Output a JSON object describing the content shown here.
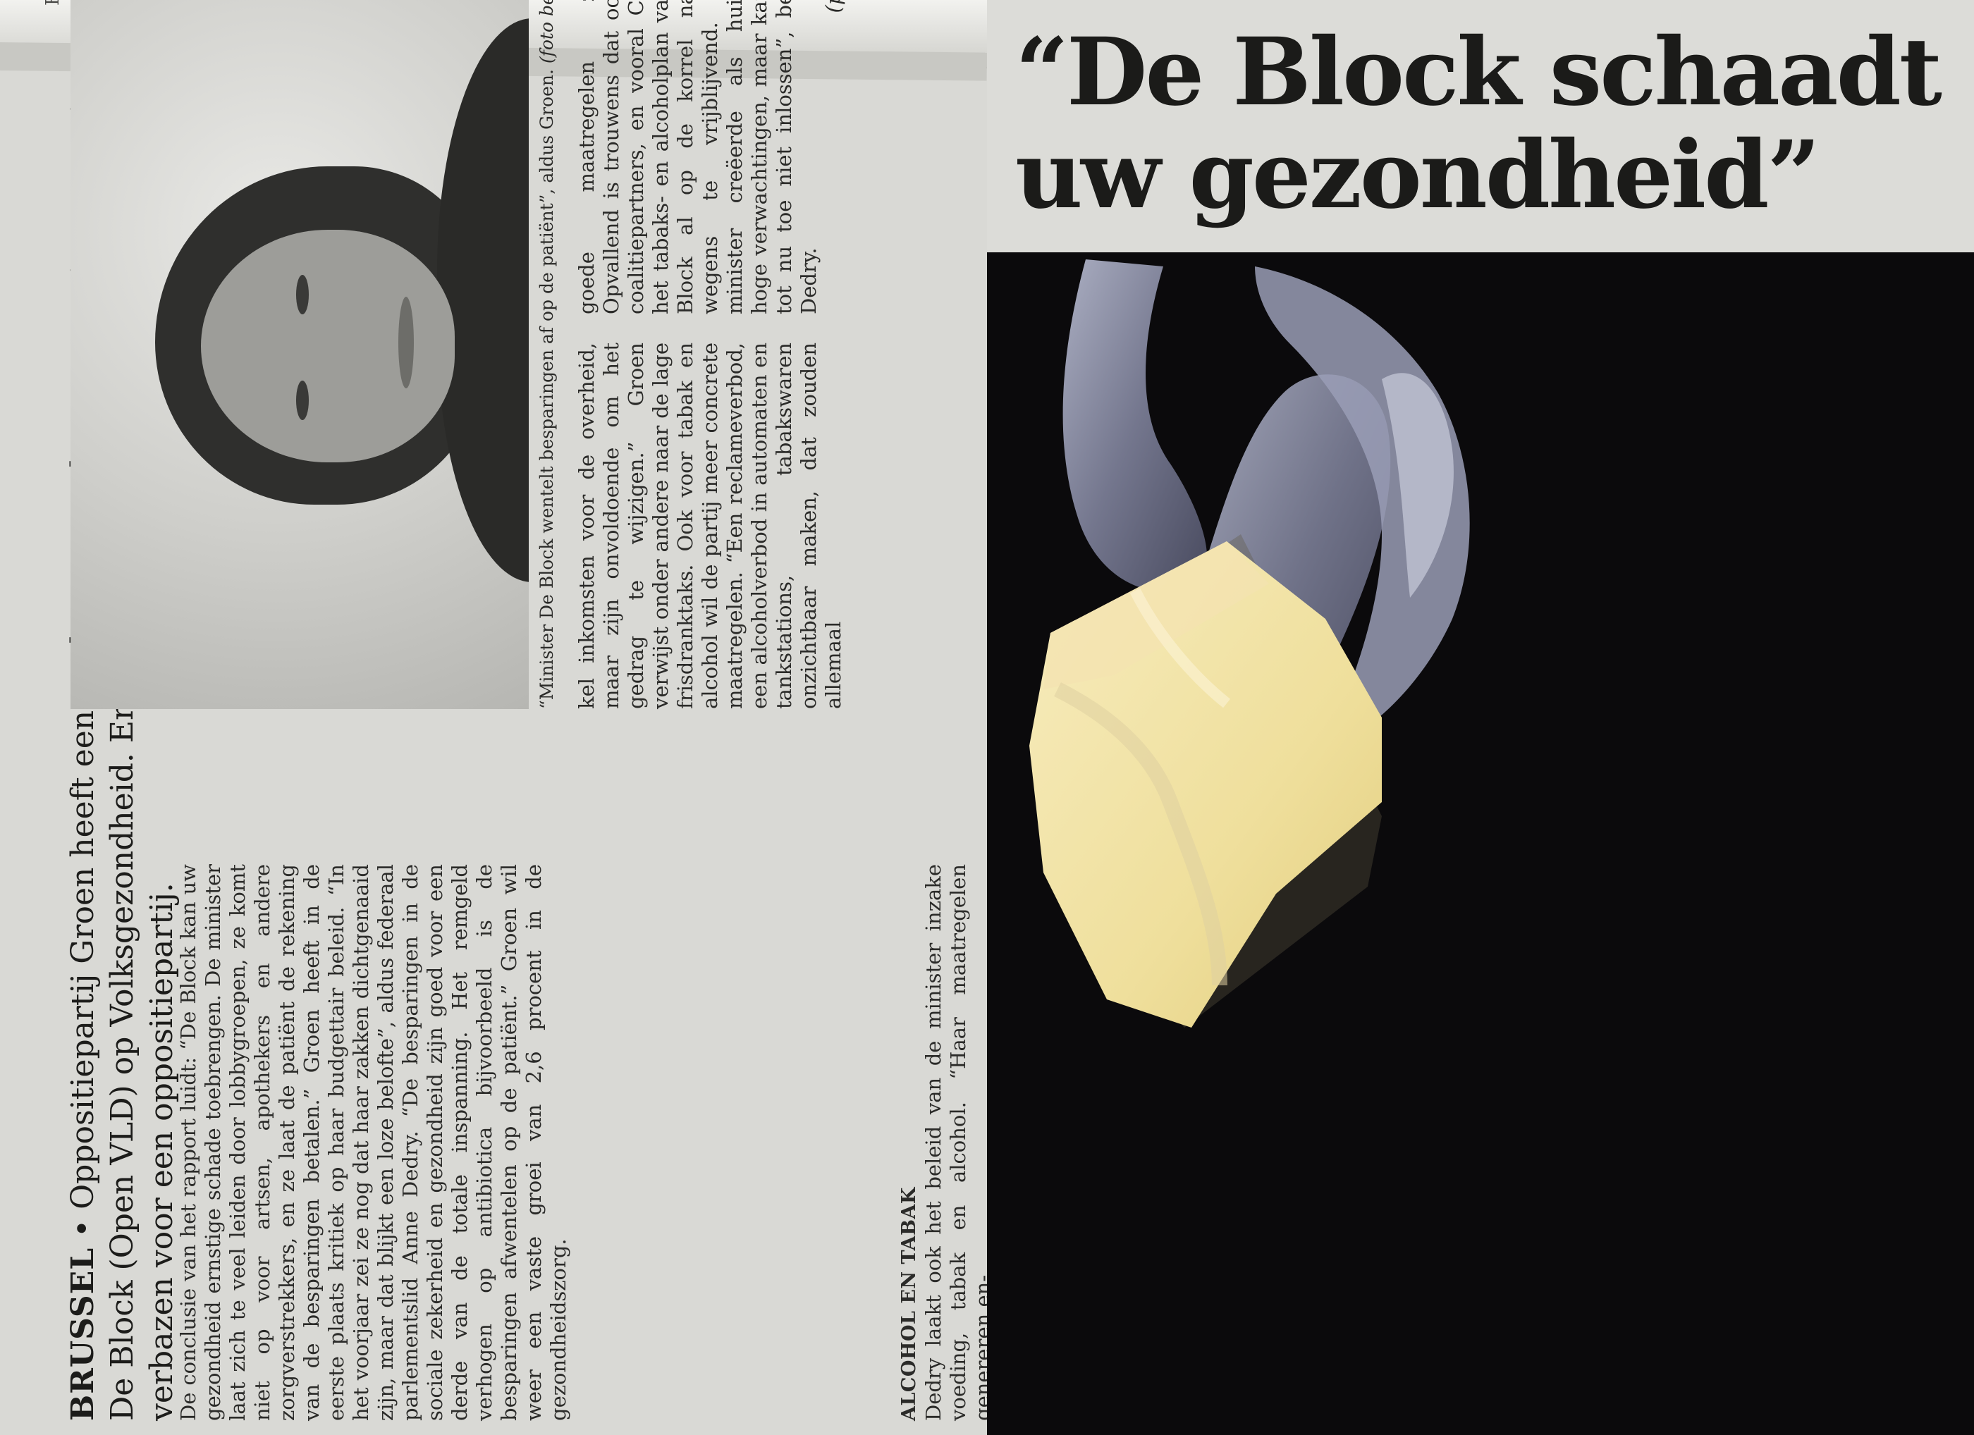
{
  "clipping": {
    "strip_text": "Fr",
    "dateline": "BRUSSEL",
    "lead": " • Oppositiepartij Groen heeft een analyse gemaakt van twee jaar Maggie De Block (Open VLD) op Volksgezondheid. En die is vernietigend. Al mag dat niet verbazen voor een oppositiepartij.",
    "col1": "De conclusie van het rapport luidt: “De Block kan uw gezondheid ernstige schade toebrengen. De minister laat zich te veel leiden door lobbygroepen, ze komt niet op voor artsen, apothekers en andere zorgverstrekkers, en ze laat de patiënt de rekening van de besparingen betalen.” Groen heeft in de eerste plaats kritiek op haar budgettair beleid. “In het voorjaar zei ze nog dat haar zakken dichtgenaaid zijn, maar dat blijkt een loze belofte”, aldus federaal parlementslid Anne Dedry. “De besparingen in de sociale zekerheid en gezondheid zijn goed voor een derde van de totale inspanning. Het remgeld verhogen op antibiotica bijvoorbeeld is de besparingen afwentelen op de patiënt.” Groen wil weer een vaste groei van 2,6 procent in de gezondheidszorg.",
    "subhead": "ALCOHOL EN TABAK",
    "col2": "Dedry laakt ook het beleid van de minister inzake voeding, tabak en alcohol. “Haar maatregelen genereren en-",
    "caption": "“Minister De Block wentelt besparingen af op de patiënt”, aldus Groen.",
    "photo_credit": "(foto belga)",
    "col3": "kel inkomsten voor de overheid, maar zijn onvoldoende om het gedrag te wijzigen.” Groen verwijst onder andere naar de lage frisdranktaks. Ook voor tabak en alcohol wil de partij meer concrete maatregelen. “Een reclameverbod, een alcoholverbod in automaten en tankstations, tabakswaren onzichtbaar maken, dat zouden allemaal",
    "col4": "goede maatregelen zijn.” Opvallend is trouwens dat ook de coalitiepartners, en vooral CD&V, het tabaks- en alcoholplan van De Block al op de korrel namen wegens te vrijblijvend. “De minister creëerde als huisarts hoge verwachtingen, maar kan die tot nu toe niet inlossen”, besluit Dedry.",
    "byline": "(pcok)"
  },
  "art": {
    "title": "“De Block schaadt uw gezondheid”",
    "colors": {
      "background": "#0b0a0c",
      "paint": "#8c8fa8",
      "butter": "#f2e4a6"
    }
  }
}
